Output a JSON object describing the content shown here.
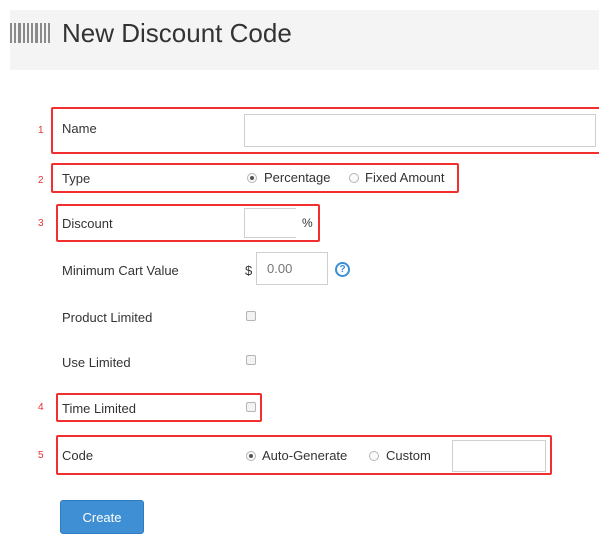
{
  "page": {
    "title": "New Discount Code",
    "icon": "barcode-icon"
  },
  "markers": [
    "1",
    "2",
    "3",
    "4",
    "5"
  ],
  "form": {
    "name": {
      "label": "Name",
      "value": "",
      "placeholder": ""
    },
    "type": {
      "label": "Type",
      "options": [
        "Percentage",
        "Fixed Amount"
      ],
      "selected": "Percentage"
    },
    "discount": {
      "label": "Discount",
      "value": "",
      "suffix": "%"
    },
    "min_cart": {
      "label": "Minimum Cart Value",
      "currency": "$",
      "placeholder": "0.00",
      "help_icon": "question-circle-icon",
      "help_symbol": "?"
    },
    "product_limited": {
      "label": "Product Limited",
      "checked": false
    },
    "use_limited": {
      "label": "Use Limited",
      "checked": false
    },
    "time_limited": {
      "label": "Time Limited",
      "checked": false
    },
    "code": {
      "label": "Code",
      "options": [
        "Auto-Generate",
        "Custom"
      ],
      "selected": "Auto-Generate",
      "value": ""
    },
    "create_label": "Create"
  },
  "colors": {
    "highlight": "#f12f2f",
    "accent": "#3f8fd4",
    "header_bg": "#f4f4f4"
  }
}
